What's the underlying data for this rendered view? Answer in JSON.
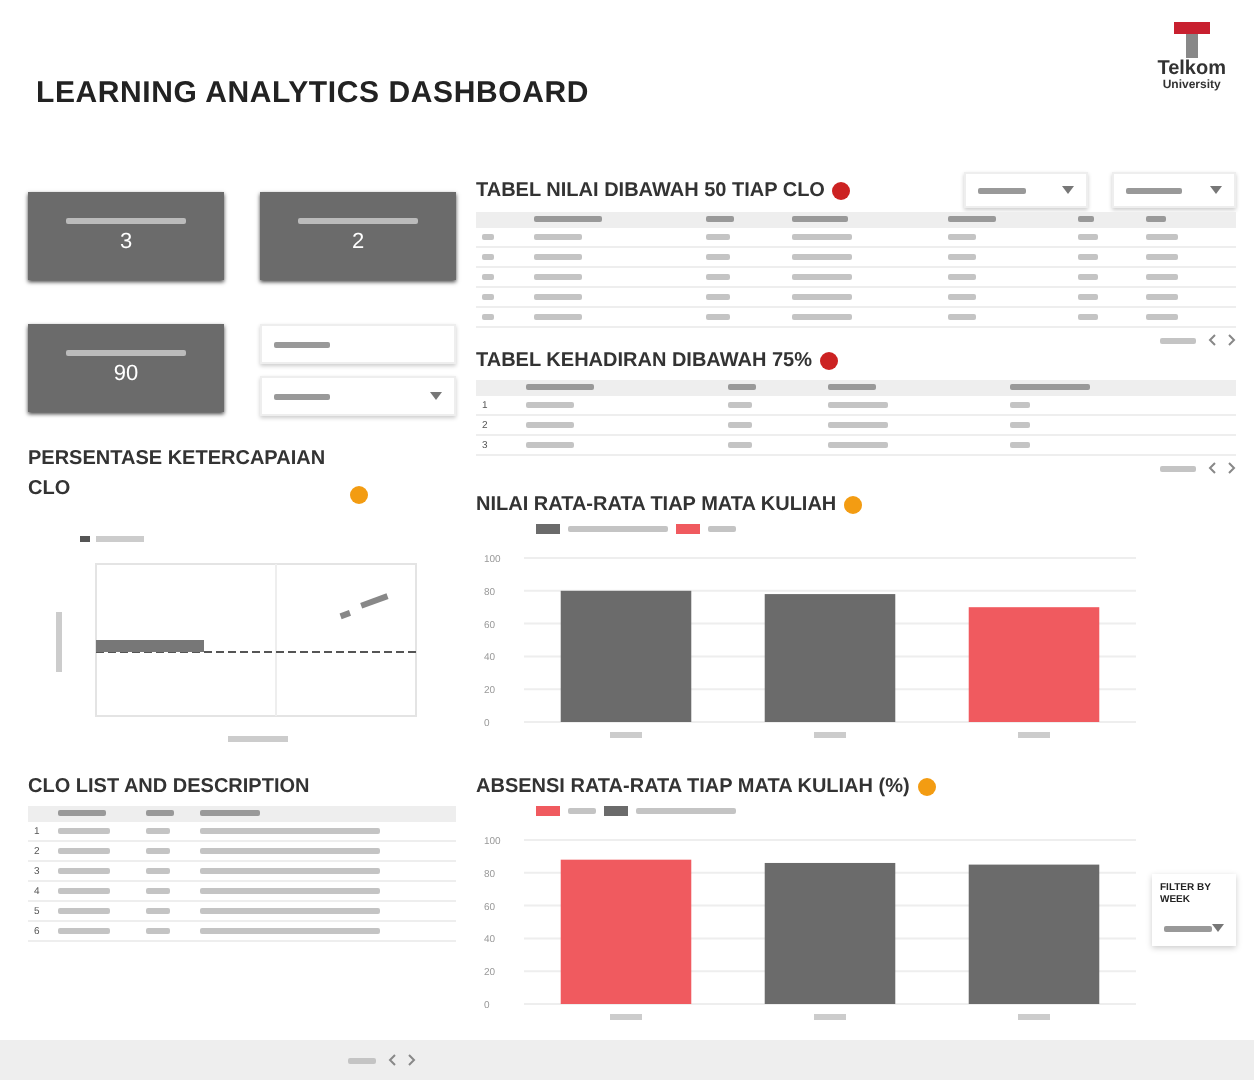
{
  "title": "LEARNING ANALYTICS DASHBOARD",
  "logo": {
    "name": "Telkom",
    "subtitle": "University"
  },
  "kpis": [
    {
      "value": "3"
    },
    {
      "value": "2"
    },
    {
      "value": "90"
    }
  ],
  "clo_chart": {
    "title": "PERSENTASE KETERCAPAIAN CLO",
    "color": "#f39c12"
  },
  "clo_list": {
    "title": "CLO LIST AND DESCRIPTION",
    "rows": [
      {
        "no": "1"
      },
      {
        "no": "2"
      },
      {
        "no": "3"
      },
      {
        "no": "4"
      },
      {
        "no": "5"
      },
      {
        "no": "6"
      }
    ]
  },
  "score_table": {
    "title": "TABEL NILAI DIBAWAH 50 TIAP CLO",
    "color": "#cc2222"
  },
  "attendance_table": {
    "title": "TABEL KEHADIRAN DIBAWAH 75%",
    "color": "#cc2222",
    "rows": [
      {
        "no": "1"
      },
      {
        "no": "2"
      },
      {
        "no": "3"
      }
    ]
  },
  "score_chart": {
    "title": "NILAI RATA-RATA TIAP MATA KULIAH",
    "color": "#f39c12",
    "chart_data": {
      "type": "bar",
      "grid": true,
      "yticks": [
        0,
        20,
        40,
        60,
        80,
        100
      ],
      "ylim": [
        0,
        100
      ],
      "series": [
        {
          "color": "#6b6b6b",
          "values": [
            80,
            78,
            null
          ]
        },
        {
          "color": "#f05a5f",
          "values": [
            null,
            null,
            70
          ]
        }
      ]
    }
  },
  "attendance_chart": {
    "title": "ABSENSI RATA-RATA TIAP MATA KULIAH (%)",
    "color": "#f39c12",
    "chart_data": {
      "type": "bar",
      "grid": true,
      "yticks": [
        0,
        20,
        40,
        60,
        80,
        100
      ],
      "ylim": [
        0,
        100
      ],
      "series": [
        {
          "color": "#f05a5f",
          "values": [
            88,
            null,
            null
          ]
        },
        {
          "color": "#6b6b6b",
          "values": [
            null,
            86,
            85
          ]
        }
      ]
    }
  },
  "week_filter": {
    "label": "FILTER BY WEEK"
  }
}
